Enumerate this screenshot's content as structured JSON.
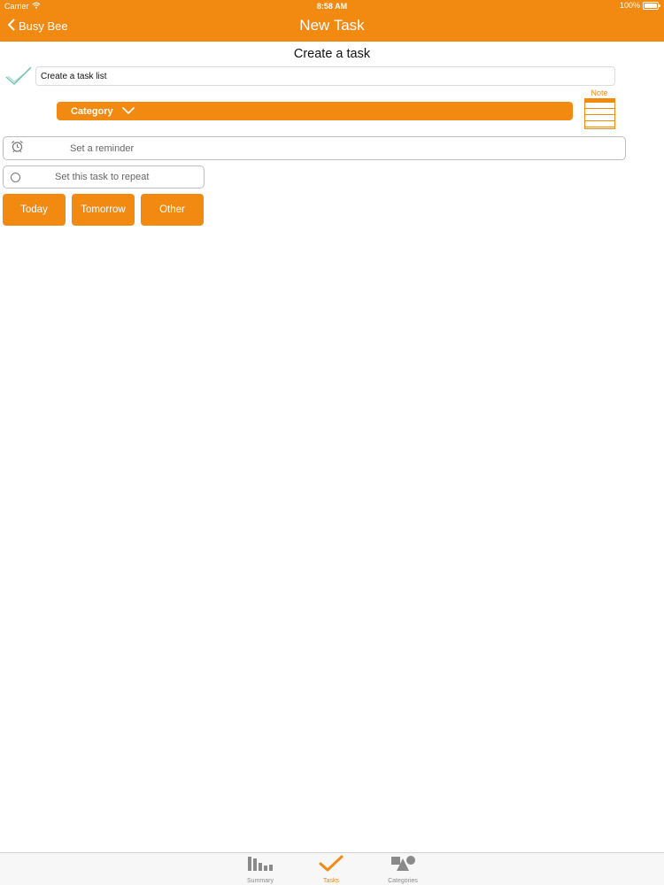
{
  "status_bar": {
    "carrier": "Carrier",
    "time": "8:58 AM",
    "battery": "100%"
  },
  "nav": {
    "back_label": "Busy Bee",
    "title": "New Task"
  },
  "form": {
    "section_title": "Create a task",
    "task_input_value": "Create a task list",
    "category_label": "Category",
    "note_label": "Note",
    "reminder_label": "Set a reminder",
    "repeat_label": "Set this task to repeat",
    "day_buttons": [
      "Today",
      "Tomorrow",
      "Other"
    ]
  },
  "tabs": [
    {
      "label": "Summary",
      "icon": "bar-chart-icon",
      "active": false
    },
    {
      "label": "Tasks",
      "icon": "checkmark-icon",
      "active": true
    },
    {
      "label": "Categories",
      "icon": "shapes-icon",
      "active": false
    }
  ],
  "colors": {
    "accent": "#f28a12",
    "check": "#6fc3b0"
  }
}
